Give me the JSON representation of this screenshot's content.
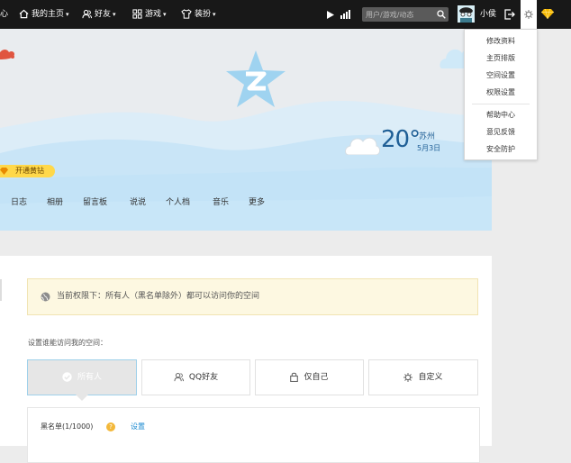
{
  "topbar": {
    "cut_nav_text": "心",
    "nav": [
      {
        "label": "我的主页",
        "icon": "home-icon"
      },
      {
        "label": "好友",
        "icon": "friends-icon"
      },
      {
        "label": "游戏",
        "icon": "apps-grid-icon"
      },
      {
        "label": "装扮",
        "icon": "shirt-icon"
      }
    ],
    "search_placeholder": "用户/游戏/动态",
    "username": "小侯"
  },
  "dropdown": {
    "items": [
      "修改资料",
      "主页排版",
      "空间设置",
      "权限设置",
      "帮助中心",
      "意见反馈",
      "安全防护"
    ]
  },
  "banner": {
    "vip_label": "开通黄钻",
    "weather": {
      "temperature": "20°",
      "city": "苏州",
      "date": "5月3日"
    }
  },
  "profile_nav": [
    "日志",
    "相册",
    "留言板",
    "说说",
    "个人档",
    "音乐",
    "更多"
  ],
  "permission": {
    "notice": "当前权限下：所有人（黑名单除外）都可以访问你的空间",
    "section_label": "设置谁能访问我的空间：",
    "options": [
      {
        "label": "所有人",
        "icon": "check-icon",
        "active": true
      },
      {
        "label": "QQ好友",
        "icon": "friends-icon",
        "active": false
      },
      {
        "label": "仅自己",
        "icon": "lock-icon",
        "active": false
      },
      {
        "label": "自定义",
        "icon": "gear-icon",
        "active": false
      }
    ],
    "blacklist_label": "黑名单(1/1000)",
    "blacklist_help": "?",
    "blacklist_link": "设置"
  },
  "colors": {
    "topbar": "#181818",
    "banner_sky": "#c3e3f7",
    "vip_yellow": "#ffd84a",
    "link_blue": "#1b8ad1",
    "notice_bg": "#fdf8e1"
  }
}
